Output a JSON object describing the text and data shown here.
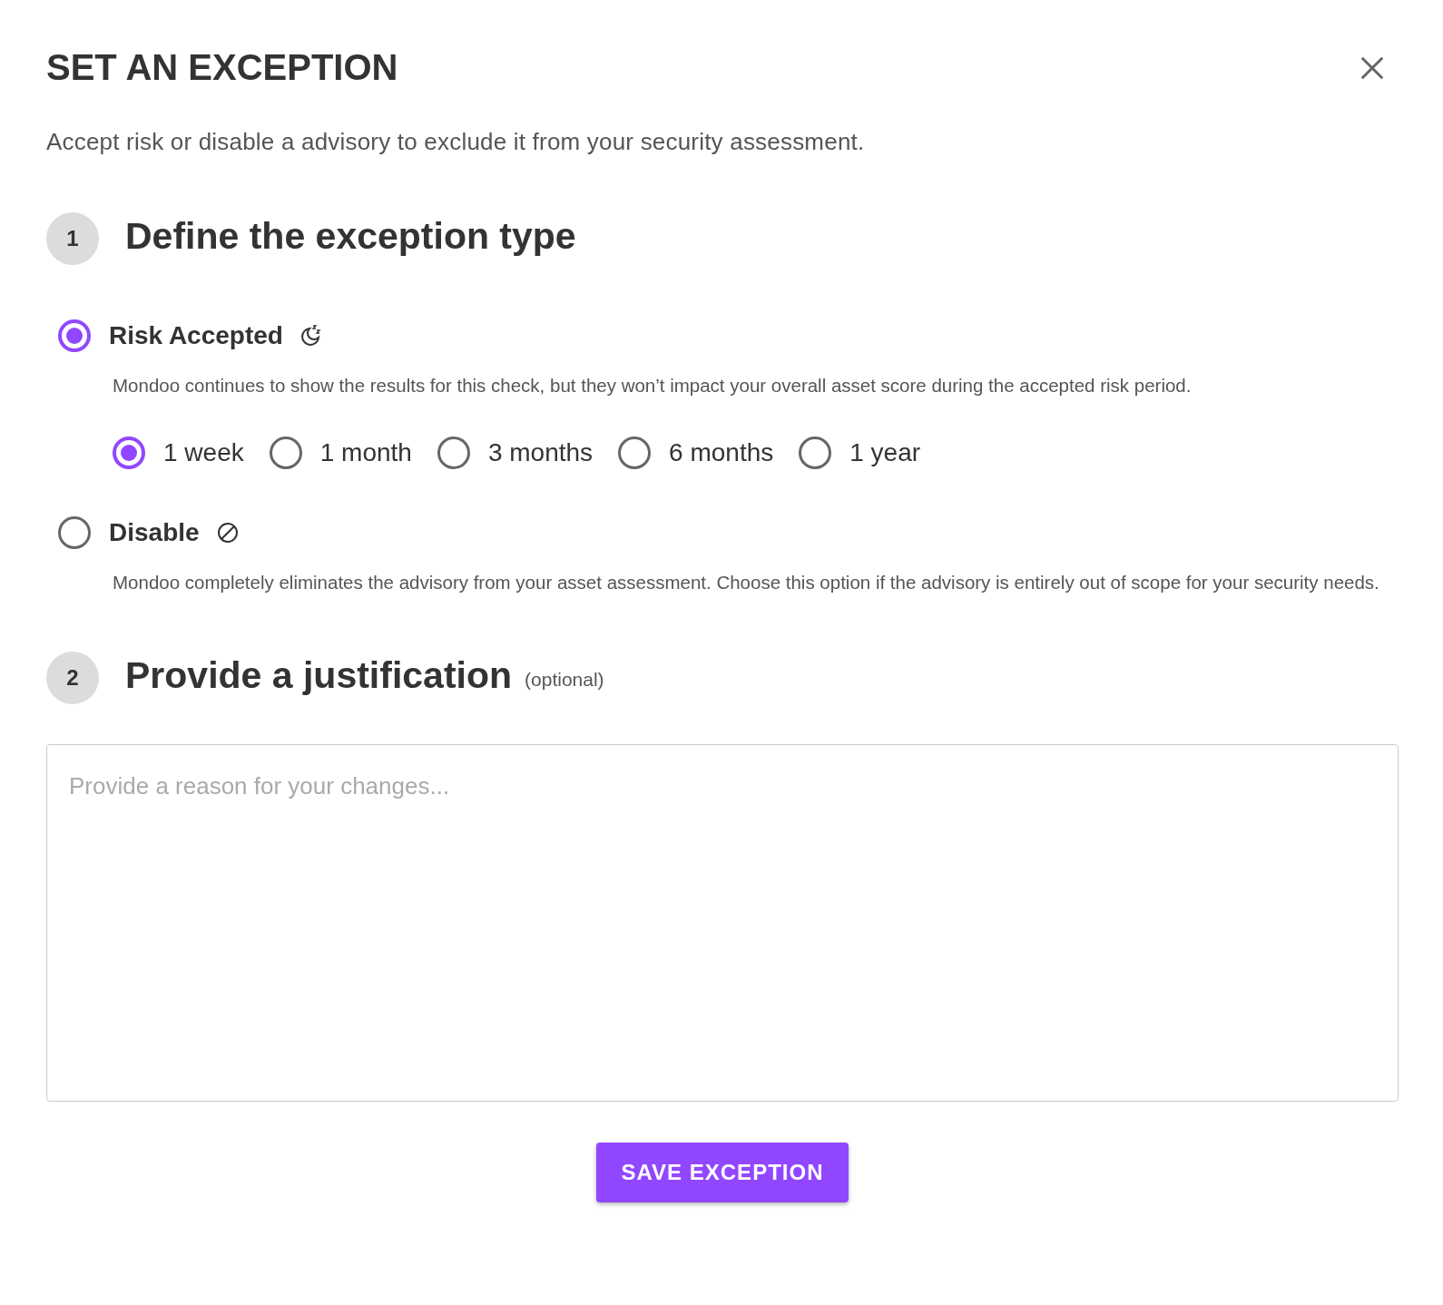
{
  "dialog": {
    "title": "SET AN EXCEPTION",
    "subtitle": "Accept risk or disable a advisory to exclude it from your security assessment."
  },
  "step_1": {
    "number": "1",
    "heading": "Define the exception type",
    "options": [
      {
        "kind": "risk",
        "label": "Risk Accepted",
        "selected": true,
        "description": "Mondoo continues to show the results for this check, but they won’t impact your overall asset score during the accepted risk period.",
        "durations": [
          {
            "label": "1 week",
            "selected": true
          },
          {
            "label": "1 month",
            "selected": false
          },
          {
            "label": "3 months",
            "selected": false
          },
          {
            "label": "6 months",
            "selected": false
          },
          {
            "label": "1 year",
            "selected": false
          }
        ]
      },
      {
        "kind": "disable",
        "label": "Disable",
        "selected": false,
        "description": "Mondoo completely eliminates the advisory from your asset assessment. Choose this option if the advisory is entirely out of scope for your security needs."
      }
    ]
  },
  "step_2": {
    "number": "2",
    "heading": "Provide a justification",
    "note": "(optional)",
    "field": {
      "placeholder": "Provide a reason for your changes..."
    }
  },
  "save_button": {
    "label": "SAVE EXCEPTION"
  }
}
